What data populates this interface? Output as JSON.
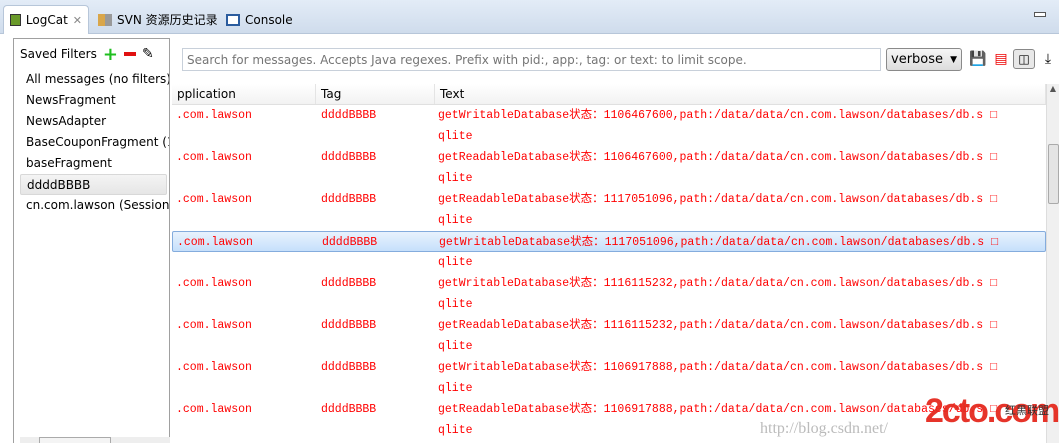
{
  "tabs": [
    {
      "label": "LogCat",
      "icon": "logcat-icon",
      "active": true
    },
    {
      "label": "SVN 资源历史记录",
      "icon": "svn-history-icon"
    },
    {
      "label": "Console",
      "icon": "console-icon"
    }
  ],
  "filters": {
    "title": "Saved Filters",
    "items": [
      "All messages (no filters)",
      "NewsFragment",
      "NewsAdapter",
      "BaseCouponFragment (1",
      "baseFragment",
      "ddddBBBB",
      "cn.com.lawson (Session"
    ],
    "selected": "ddddBBBB"
  },
  "search": {
    "placeholder": "Search for messages. Accepts Java regexes. Prefix with pid:, app:, tag: or text: to limit scope."
  },
  "level": {
    "value": "verbose"
  },
  "columns": [
    "pplication",
    "Tag",
    "Text"
  ],
  "rows": [
    {
      "app": ".com.lawson",
      "tag": "ddddBBBB",
      "text": "getWritableDatabase状态：1106467600,path:/data/data/cn.com.lawson/databases/db.s □",
      "cont": "qlite"
    },
    {
      "app": ".com.lawson",
      "tag": "ddddBBBB",
      "text": "getReadableDatabase状态：1106467600,path:/data/data/cn.com.lawson/databases/db.s □",
      "cont": "qlite"
    },
    {
      "app": ".com.lawson",
      "tag": "ddddBBBB",
      "text": "getReadableDatabase状态：1117051096,path:/data/data/cn.com.lawson/databases/db.s □",
      "cont": "qlite"
    },
    {
      "app": ".com.lawson",
      "tag": "ddddBBBB",
      "text": "getWritableDatabase状态：1117051096,path:/data/data/cn.com.lawson/databases/db.s □",
      "cont": "qlite",
      "selected": true
    },
    {
      "app": ".com.lawson",
      "tag": "ddddBBBB",
      "text": "getWritableDatabase状态：1116115232,path:/data/data/cn.com.lawson/databases/db.s □",
      "cont": "qlite"
    },
    {
      "app": ".com.lawson",
      "tag": "ddddBBBB",
      "text": "getReadableDatabase状态：1116115232,path:/data/data/cn.com.lawson/databases/db.s □",
      "cont": "qlite"
    },
    {
      "app": ".com.lawson",
      "tag": "ddddBBBB",
      "text": "getWritableDatabase状态：1106917888,path:/data/data/cn.com.lawson/databases/db.s □",
      "cont": "qlite"
    },
    {
      "app": ".com.lawson",
      "tag": "ddddBBBB",
      "text": "getReadableDatabase状态：1106917888,path:/data/data/cn.com.lawson/databases/db.s □",
      "cont": "qlite"
    }
  ],
  "watermark": {
    "logo": "2cto.com",
    "tagline": "红黑联盟",
    "url": "http://blog.csdn.net/"
  },
  "colors": {
    "log_text": "#ff0000",
    "selection": "#c6e0fb"
  }
}
